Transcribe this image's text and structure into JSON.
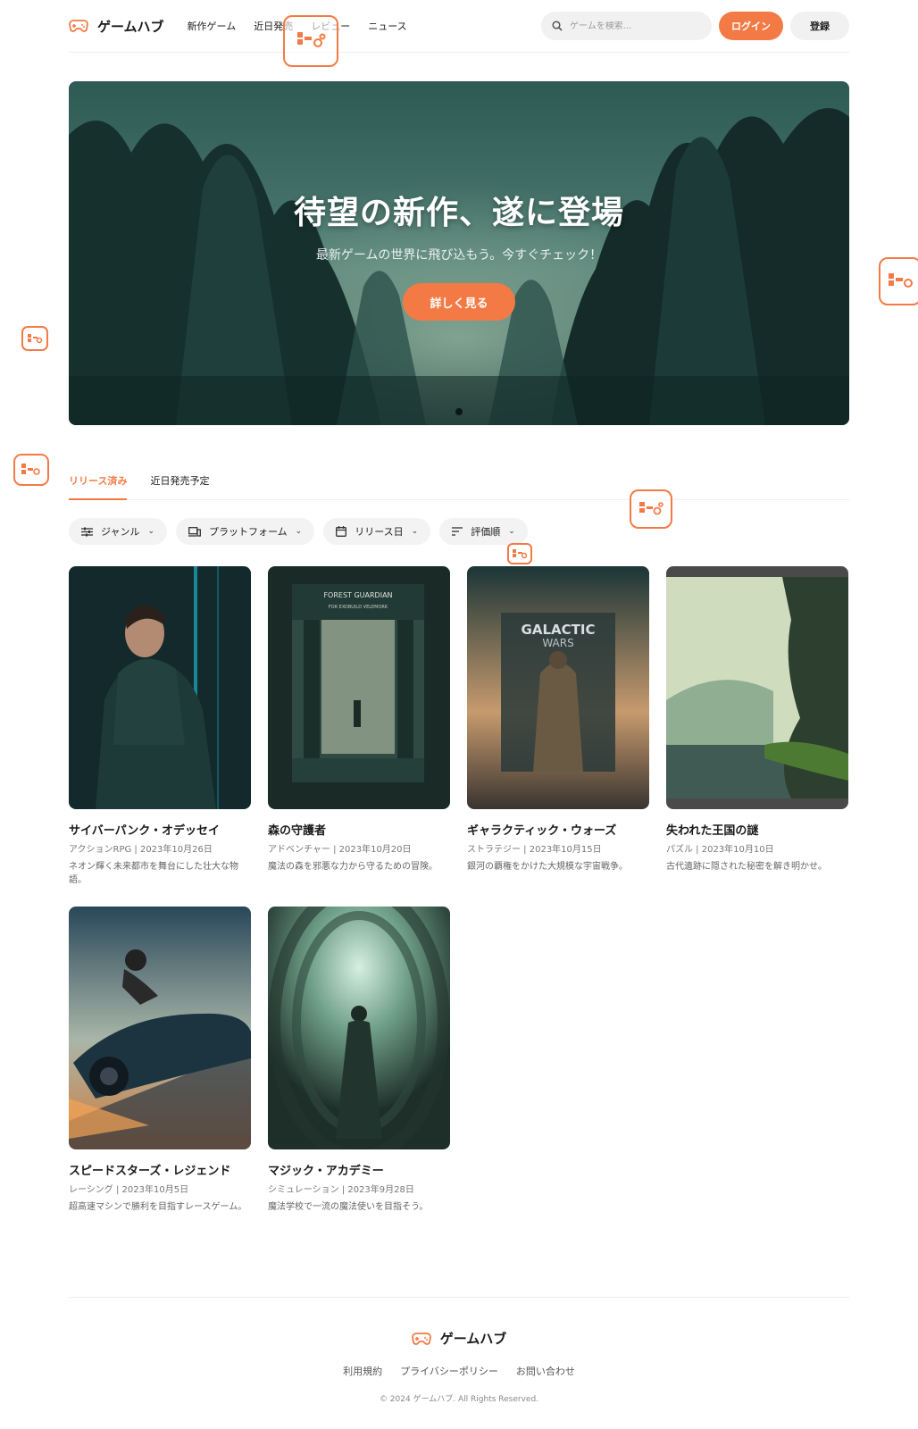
{
  "header": {
    "brand": "ゲームハブ",
    "nav": [
      {
        "label": "新作ゲーム"
      },
      {
        "label": "近日発売"
      },
      {
        "label": "レビュー"
      },
      {
        "label": "ニュース"
      }
    ],
    "search_placeholder": "ゲームを検索...",
    "login_label": "ログイン",
    "register_label": "登録"
  },
  "hero": {
    "title": "待望の新作、遂に登場",
    "subtitle": "最新ゲームの世界に飛び込もう。今すぐチェック！",
    "cta_label": "詳しく見る"
  },
  "tabs": [
    {
      "label": "リリース済み",
      "active": true
    },
    {
      "label": "近日発売予定",
      "active": false
    }
  ],
  "filters": [
    {
      "label": "ジャンル",
      "icon": "sliders-icon"
    },
    {
      "label": "プラットフォーム",
      "icon": "devices-icon"
    },
    {
      "label": "リリース日",
      "icon": "calendar-icon"
    },
    {
      "label": "評価順",
      "icon": "sort-icon"
    }
  ],
  "games": [
    {
      "title": "サイバーパンク・オデッセイ",
      "meta": "アクションRPG | 2023年10月26日",
      "desc": "ネオン輝く未来都市を舞台にした壮大な物語。"
    },
    {
      "title": "森の守護者",
      "meta": "アドベンチャー | 2023年10月20日",
      "desc": "魔法の森を邪悪な力から守るための冒険。",
      "cover_text": [
        "FOREST GUARDIAN",
        "FOR EXOBUILD VELEMORK"
      ]
    },
    {
      "title": "ギャラクティック・ウォーズ",
      "meta": "ストラテジー | 2023年10月15日",
      "desc": "銀河の覇権をかけた大規模な宇宙戦争。",
      "cover_text": [
        "GALACTIC",
        "WARS"
      ]
    },
    {
      "title": "失われた王国の謎",
      "meta": "パズル | 2023年10月10日",
      "desc": "古代遺跡に隠された秘密を解き明かせ。"
    },
    {
      "title": "スピードスターズ・レジェンド",
      "meta": "レーシング | 2023年10月5日",
      "desc": "超高速マシンで勝利を目指すレースゲーム。"
    },
    {
      "title": "マジック・アカデミー",
      "meta": "シミュレーション | 2023年9月28日",
      "desc": "魔法学校で一流の魔法使いを目指そう。"
    }
  ],
  "footer": {
    "brand": "ゲームハブ",
    "links": [
      {
        "label": "利用規約"
      },
      {
        "label": "プライバシーポリシー"
      },
      {
        "label": "お問い合わせ"
      }
    ],
    "copyright": "© 2024 ゲームハブ. All Rights Reserved."
  },
  "colors": {
    "accent": "#f47a45",
    "hero_dark": "#0f2a2a"
  }
}
